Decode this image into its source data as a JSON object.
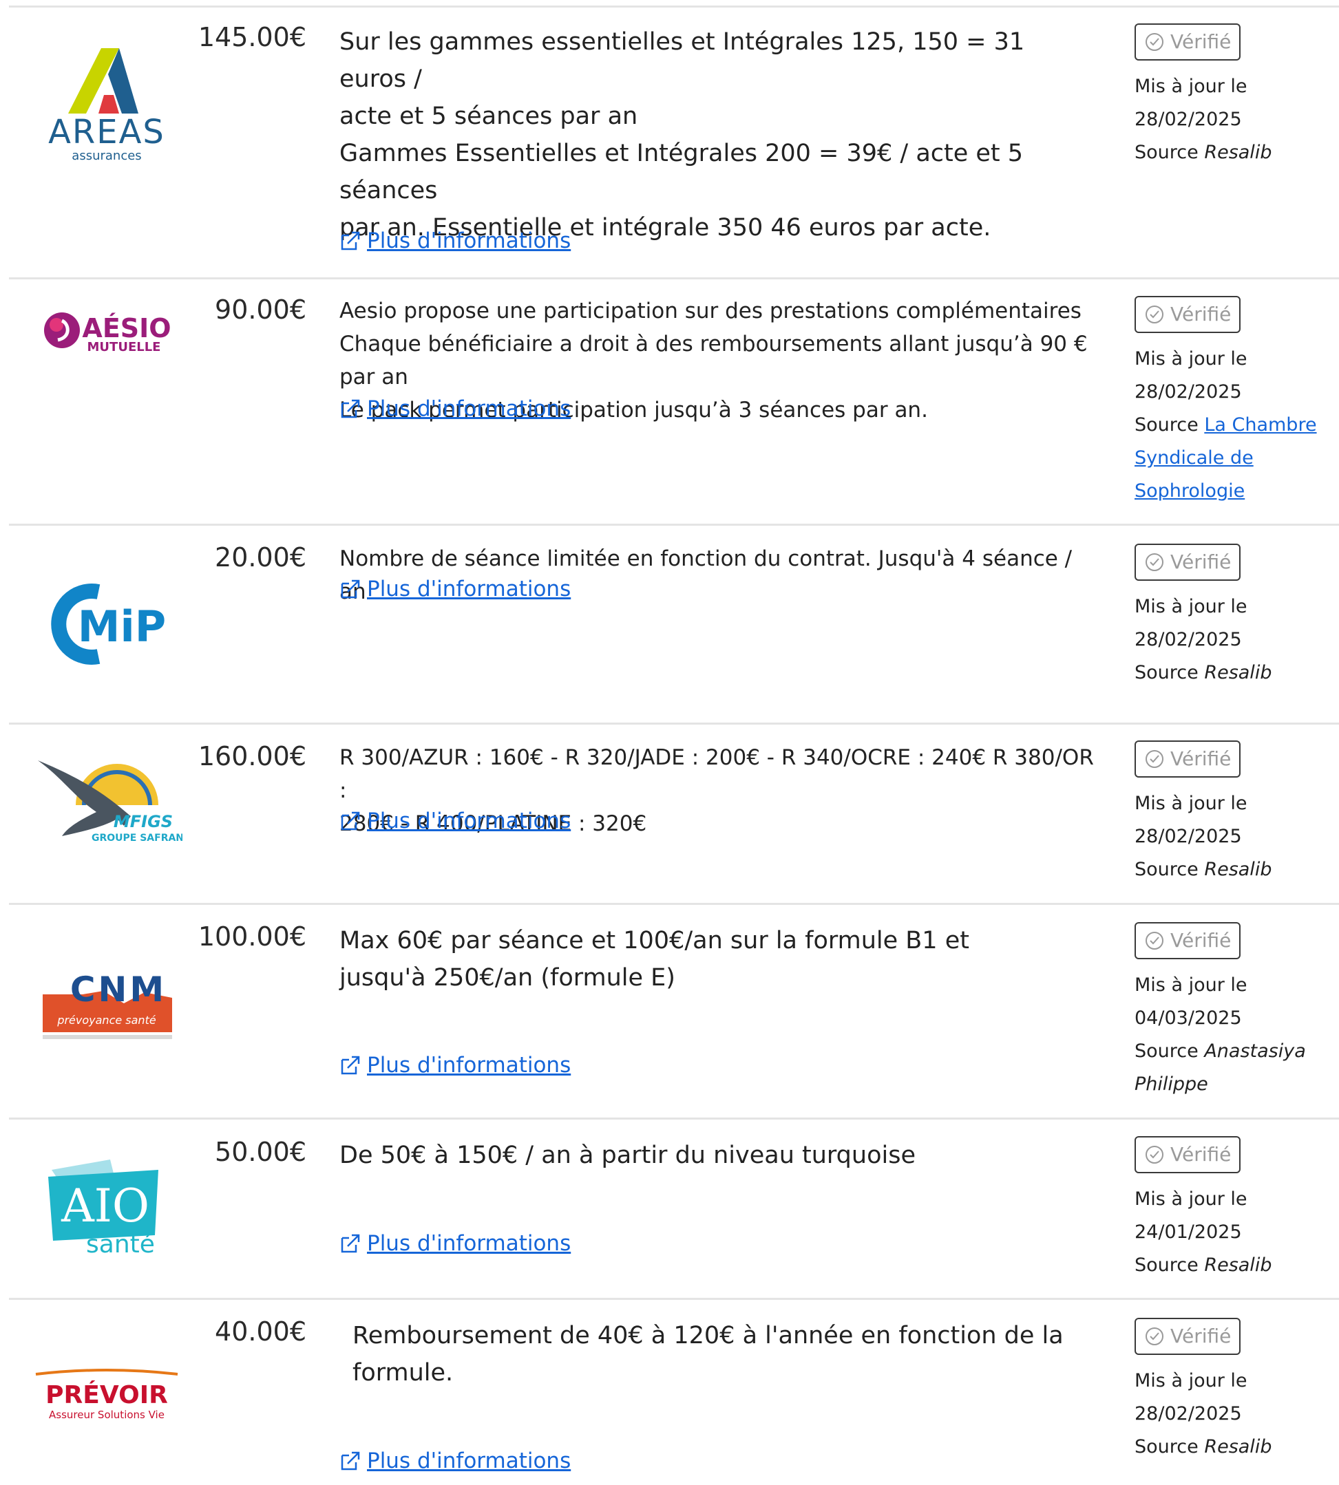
{
  "common": {
    "verified_label": "Vérifié",
    "updated_label": "Mis à jour le",
    "source_label": "Source",
    "more_label": "Plus d'informations"
  },
  "rows": [
    {
      "logo": "AREAS assurances",
      "logo_main": "AREAS",
      "logo_sub": "assurances",
      "price": "145.00€",
      "desc": [
        "Sur les gammes essentielles et Intégrales 125, 150 = 31 euros /",
        "acte et 5 séances par an",
        "Gammes Essentielles et Intégrales 200 = 39€ / acte et 5 séances",
        "par an. Essentielle et intégrale 350 46 euros par acte."
      ],
      "date": "28/02/2025",
      "source": "Resalib"
    },
    {
      "logo": "AÉSIO MUTUELLE",
      "logo_main": "AÉSIO",
      "logo_sub": "MUTUELLE",
      "price": "90.00€",
      "desc": [
        "Aesio propose une participation sur des prestations complémentaires",
        "Chaque bénéficiaire a droit à des remboursements allant jusqu’à 90 € par an",
        "Le pack permet participation jusqu’à 3 séances par an."
      ],
      "date": "28/02/2025",
      "source_link": [
        "La Chambre",
        "Syndicale de",
        "Sophrologie"
      ]
    },
    {
      "logo": "MIP",
      "logo_main": "MiP",
      "price": "20.00€",
      "desc": [
        "Nombre de séance limitée en fonction du contrat. Jusqu'à 4 séance / an"
      ],
      "date": "28/02/2025",
      "source": "Resalib"
    },
    {
      "logo": "MFIGS GROUPE SAFRAN",
      "logo_main": "MFIGS",
      "logo_sub": "GROUPE SAFRAN",
      "price": "160.00€",
      "desc": [
        "R 300/AZUR : 160€ - R 320/JADE : 200€ - R 340/OCRE : 240€ R 380/OR :",
        "280€ - R 400/PLATINE : 320€"
      ],
      "date": "28/02/2025",
      "source": "Resalib"
    },
    {
      "logo": "CNM prévoyance santé",
      "logo_main": "CNM",
      "logo_sub": "prévoyance santé",
      "price": "100.00€",
      "desc": [
        "Max 60€ par séance et 100€/an sur la formule B1 et",
        "jusqu'à 250€/an (formule E)"
      ],
      "date": "04/03/2025",
      "source": [
        "Anastasiya",
        "Philippe"
      ]
    },
    {
      "logo": "AIO santé",
      "logo_main": "AIO",
      "logo_sub": "santé",
      "price": "50.00€",
      "desc": [
        "De 50€ à 150€ / an à partir du niveau turquoise"
      ],
      "date": "24/01/2025",
      "source": "Resalib"
    },
    {
      "logo": "PRÉVOIR Assureur Solutions Vie",
      "logo_main": "PRÉVOIR",
      "logo_sub": "Assureur Solutions Vie",
      "price": "40.00€",
      "desc": [
        "Remboursement de 40€ à 120€ à l'année en fonction de la",
        "formule."
      ],
      "date": "28/02/2025",
      "source": "Resalib"
    }
  ],
  "colors": {
    "link": "#1565d8",
    "areas_blue": "#1f5f8f",
    "areas_green": "#c8d400",
    "areas_red": "#e03a3e",
    "aesio_purple": "#9b1d7a",
    "mip_blue": "#1185c8",
    "cnm_blue": "#1d4e8f",
    "cnm_orange": "#e0512a",
    "aio_teal": "#1fb5c9",
    "prevoir_orange": "#e67817",
    "prevoir_red": "#c8102e"
  }
}
